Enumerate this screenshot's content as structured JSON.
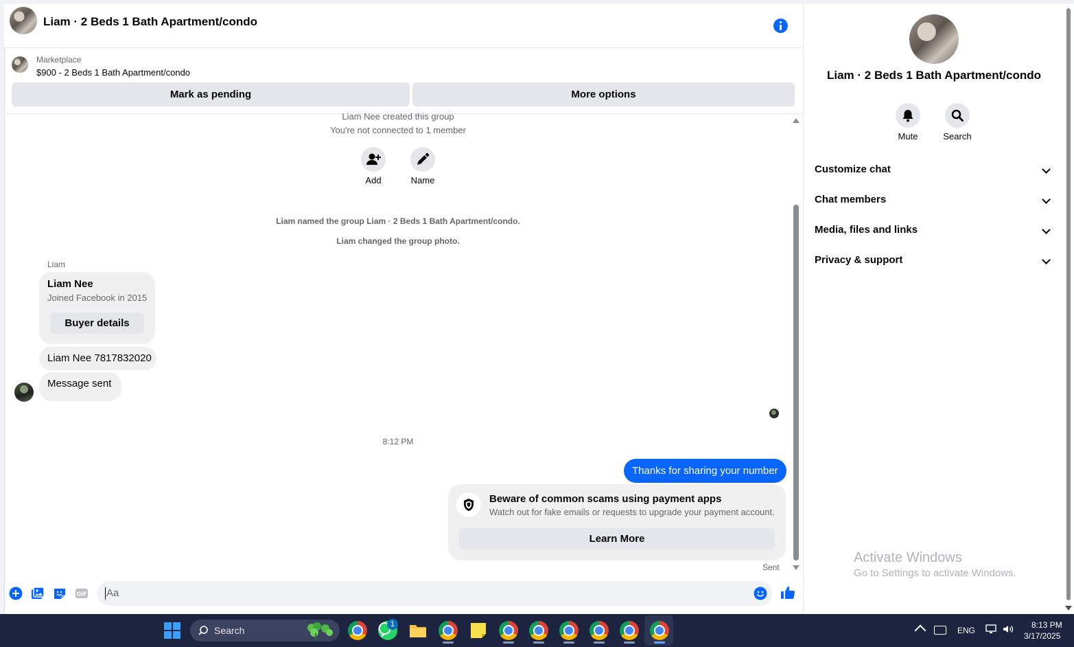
{
  "header": {
    "title": "Liam · 2 Beds 1 Bath Apartment/condo"
  },
  "marketplace": {
    "label": "Marketplace",
    "listing": "$900 - 2 Beds 1 Bath Apartment/condo",
    "mark_pending": "Mark as pending",
    "more_options": "More options"
  },
  "conversation": {
    "created": "Liam Nee created this group",
    "not_connected": "You're not connected to 1 member",
    "add_label": "Add",
    "name_label": "Name",
    "named_group": "Liam named the group Liam · 2 Beds 1 Bath Apartment/condo.",
    "changed_photo": "Liam changed the group photo.",
    "sender": "Liam",
    "card_name": "Liam Nee",
    "card_sub": "Joined Facebook in 2015",
    "buyer_details": "Buyer details",
    "msg_phone": "Liam Nee 7817832020",
    "msg_sent": "Message sent",
    "time": "8:12 PM",
    "out_msg": "Thanks for sharing your number",
    "scam_title": "Beware of common scams using payment apps",
    "scam_text": "Watch out for fake emails or requests to upgrade your payment account.",
    "learn_more": "Learn More",
    "status": "Sent"
  },
  "composer": {
    "placeholder": "Aa"
  },
  "right_panel": {
    "title": "Liam · 2 Beds 1 Bath Apartment/condo",
    "mute": "Mute",
    "search": "Search",
    "sections": [
      "Customize chat",
      "Chat members",
      "Media, files and links",
      "Privacy & support"
    ]
  },
  "watermark": {
    "line1": "Activate Windows",
    "line2": "Go to Settings to activate Windows."
  },
  "taskbar": {
    "search": "Search",
    "whatsapp_badge": "1",
    "lang": "ENG",
    "time": "8:13 PM",
    "date": "3/17/2025"
  },
  "colors": {
    "accent": "#0866ff",
    "taskbar": "#1c2440"
  }
}
